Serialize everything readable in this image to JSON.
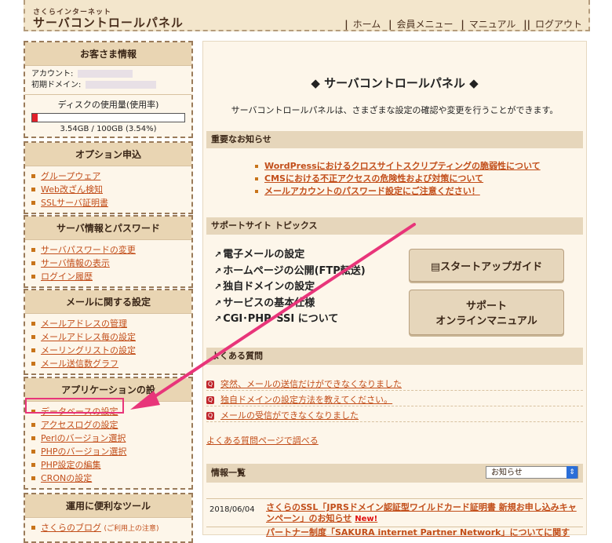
{
  "header": {
    "logo_small": "さくらインターネット",
    "logo_big": "サーバコントロールパネル",
    "nav": [
      "ホーム",
      "会員メニュー",
      "マニュアル",
      "ログアウト"
    ]
  },
  "customer": {
    "title": "お客さま情報",
    "account_label": "アカウント:",
    "domain_label": "初期ドメイン:",
    "disk_label": "ディスクの使用量(使用率)",
    "disk_text": "3.54GB / 100GB (3.54%)",
    "disk_percent": 3.54
  },
  "options": {
    "title": "オプション申込",
    "items": [
      "グループウェア",
      "Web改ざん検知",
      "SSLサーバ証明書"
    ]
  },
  "server_info": {
    "title": "サーバ情報とパスワード",
    "items": [
      "サーバパスワードの変更",
      "サーバ情報の表示",
      "ログイン履歴"
    ]
  },
  "mail": {
    "title": "メールに関する設定",
    "items": [
      "メールアドレスの管理",
      "メールアドレス毎の設定",
      "メーリングリストの設定",
      "メール送信数グラフ"
    ]
  },
  "apps": {
    "title": "アプリケーションの設",
    "items": [
      "データベースの設定",
      "アクセスログの設定",
      "Perlのバージョン選択",
      "PHPのバージョン選択",
      "PHP設定の編集",
      "CRONの設定"
    ]
  },
  "tools": {
    "title": "運用に便利なツール",
    "item": "さくらのブログ",
    "note": "(ご利用上の注意)"
  },
  "main": {
    "title": "◆ サーバコントロールパネル ◆",
    "desc": "サーバコントロールパネルは、さまざまな設定の確認や変更を行うことができます。",
    "notice_head": "重要なお知らせ",
    "notices": [
      "WordPressにおけるクロスサイトスクリプティングの脆弱性について",
      "CMSにおける不正アクセスの危険性および対策について",
      "メールアカウントのパスワード設定にご注意ください！"
    ],
    "topics_head": "サポートサイト トピックス",
    "topics": [
      "電子メールの設定",
      "ホームページの公開(FTP転送)",
      "独自ドメインの設定",
      "サービスの基本仕様",
      "CGI･PHP･SSI について"
    ],
    "btn_startup": "スタートアップガイド",
    "btn_manual_1": "サポート",
    "btn_manual_2": "オンラインマニュアル",
    "faq_head": "よくある質問",
    "faqs": [
      "突然、メールの送信だけができなくなりました",
      "独自ドメインの設定方法を教えてください。",
      "メールの受信ができなくなりました"
    ],
    "faq_link": "よくある質問ページで調べる",
    "info_head": "情報一覧",
    "info_select": "お知らせ",
    "news_date": "2018/06/04",
    "news_title": "さくらのSSL「JPRSドメイン認証型ワイルドカード証明書 新規お申し込みキャンペーン」のお知らせ",
    "news_new": "New!",
    "news2_title": "パートナー制度「SAKURA internet Partner Network」についてに関す"
  }
}
